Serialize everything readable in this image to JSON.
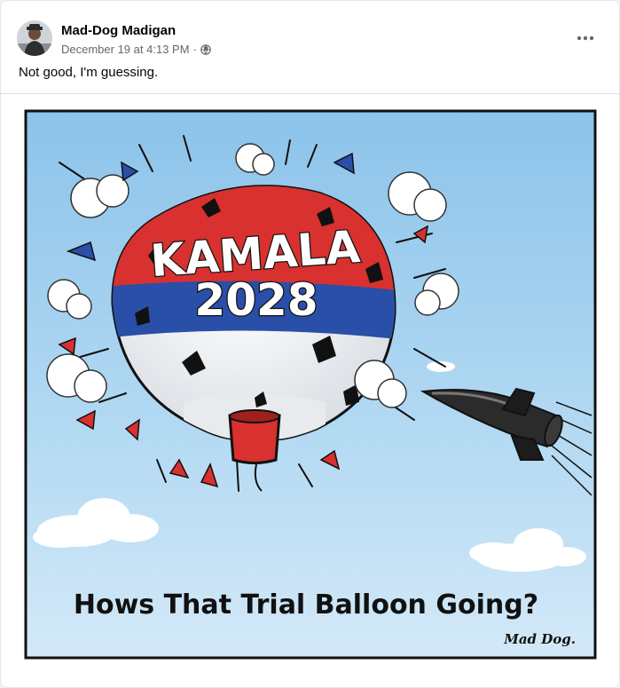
{
  "post": {
    "author": "Mad-Dog Madigan",
    "timestamp": "December 19 at 4:13 PM",
    "separator": "·",
    "privacy_icon": "globe-icon",
    "more_icon": "more-options-icon",
    "caption": "Not good, I'm guessing."
  },
  "cartoon": {
    "balloon_line1": "KAMALA",
    "balloon_line2": "2028",
    "bottom_caption": "Hows That Trial Balloon Going?",
    "signature": "Mad Dog."
  },
  "colors": {
    "accent_red": "#d8312f",
    "accent_blue": "#2a4fa8",
    "sky": "#a8d3f0",
    "meta_gray": "#65676b"
  }
}
